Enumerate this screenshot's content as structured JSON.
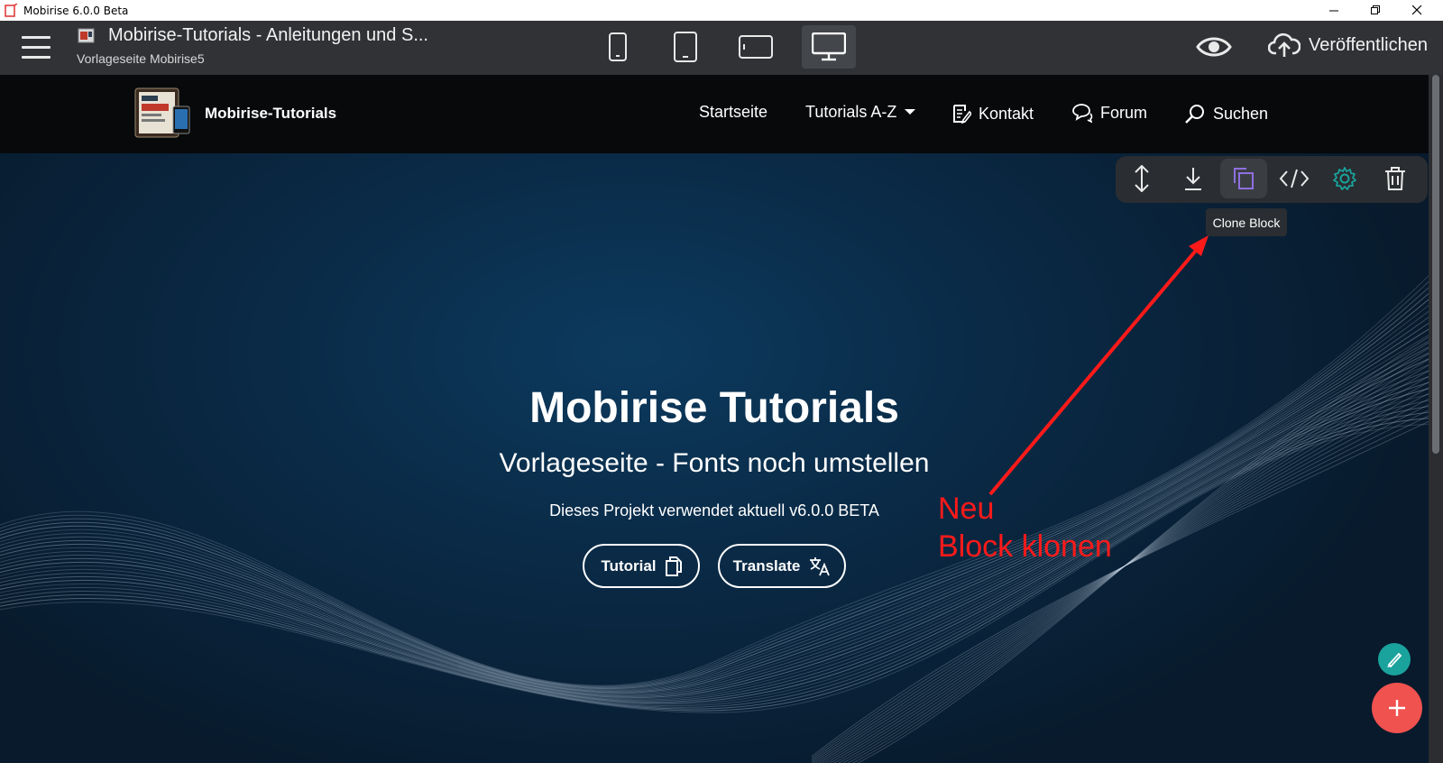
{
  "window": {
    "title": "Mobirise 6.0.0 Beta"
  },
  "toolbar": {
    "project_title": "Mobirise-Tutorials - Anleitungen und S...",
    "page_name": "Vorlageseite Mobirise5",
    "devices": [
      "mobile-portrait",
      "tablet-portrait",
      "tablet-landscape",
      "desktop"
    ],
    "active_device": "desktop",
    "publish_label": "Veröffentlichen"
  },
  "site": {
    "logo_text": "Mobirise-Tutorials",
    "nav": {
      "home": "Startseite",
      "tutorials": "Tutorials A-Z",
      "contact": "Kontakt",
      "forum": "Forum",
      "search": "Suchen"
    },
    "hero": {
      "title": "Mobirise Tutorials",
      "subtitle": "Vorlageseite - Fonts noch umstellen",
      "description": "Dieses Projekt verwendet aktuell v6.0.0 BETA",
      "btn_tutorial": "Tutorial",
      "btn_translate": "Translate"
    }
  },
  "block_tools": {
    "tooltip": "Clone Block",
    "active_tool": "clone"
  },
  "annotation": {
    "line1": "Neu",
    "line2": "Block klonen",
    "color": "#ff1a1a"
  },
  "colors": {
    "toolbar_bg": "#303236",
    "nav_bg": "#07090b",
    "hero_bg": "#0a2a46",
    "accent_teal": "#1aa39c",
    "fab_red": "#f0524f"
  }
}
